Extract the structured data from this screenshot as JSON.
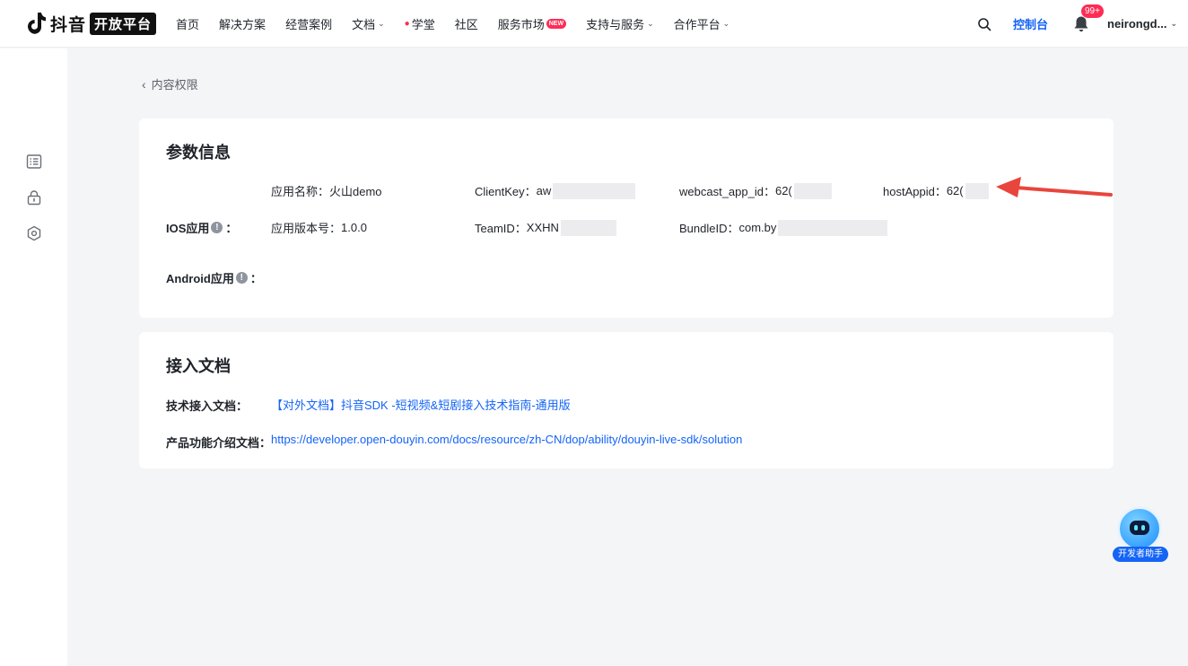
{
  "header": {
    "brand_text": "抖音",
    "brand_badge": "开放平台",
    "nav": [
      {
        "label": "首页",
        "chevron": false
      },
      {
        "label": "解决方案",
        "chevron": false
      },
      {
        "label": "经营案例",
        "chevron": false
      },
      {
        "label": "文档",
        "chevron": true
      },
      {
        "label": "学堂",
        "chevron": false,
        "flame": true
      },
      {
        "label": "社区",
        "chevron": false
      },
      {
        "label": "服务市场",
        "chevron": false,
        "badge": "NEW"
      },
      {
        "label": "支持与服务",
        "chevron": true
      },
      {
        "label": "合作平台",
        "chevron": true
      }
    ],
    "console_label": "控制台",
    "notification_count": "99+",
    "user_name": "neirongd..."
  },
  "sidebar": {
    "icons": [
      "list-icon",
      "lock-icon",
      "hexagon-settings-icon"
    ]
  },
  "breadcrumb": {
    "back_label": "内容权限"
  },
  "params_card": {
    "title": "参数信息",
    "app_name_label": "应用名称：",
    "app_name_value": "火山demo",
    "client_key_label": "ClientKey：",
    "client_key_value": "aw",
    "webcast_label": "webcast_app_id：",
    "webcast_value": "62(",
    "host_appid_label": "hostAppid：",
    "host_appid_value": "62(",
    "ios_label": "IOS应用",
    "ios_colon": "：",
    "app_version_label": "应用版本号：",
    "app_version_value": "1.0.0",
    "team_id_label": "TeamID：",
    "team_id_value": "XXHN",
    "bundle_id_label": "BundleID：",
    "bundle_id_value": "com.by",
    "android_label": "Android应用",
    "android_colon": "："
  },
  "docs_card": {
    "title": "接入文档",
    "tech_doc_label": "技术接入文档：",
    "tech_doc_link": "【对外文档】抖音SDK -短视频&短剧接入技术指南-通用版",
    "product_doc_label": "产品功能介绍文档：",
    "product_doc_link": "https://developer.open-douyin.com/docs/resource/zh-CN/dop/ability/douyin-live-sdk/solution"
  },
  "assistant": {
    "label": "开发者助手"
  },
  "colors": {
    "accent": "#1464f6",
    "brand_red": "#fe2c55",
    "annotation_arrow": "#e8453c"
  }
}
